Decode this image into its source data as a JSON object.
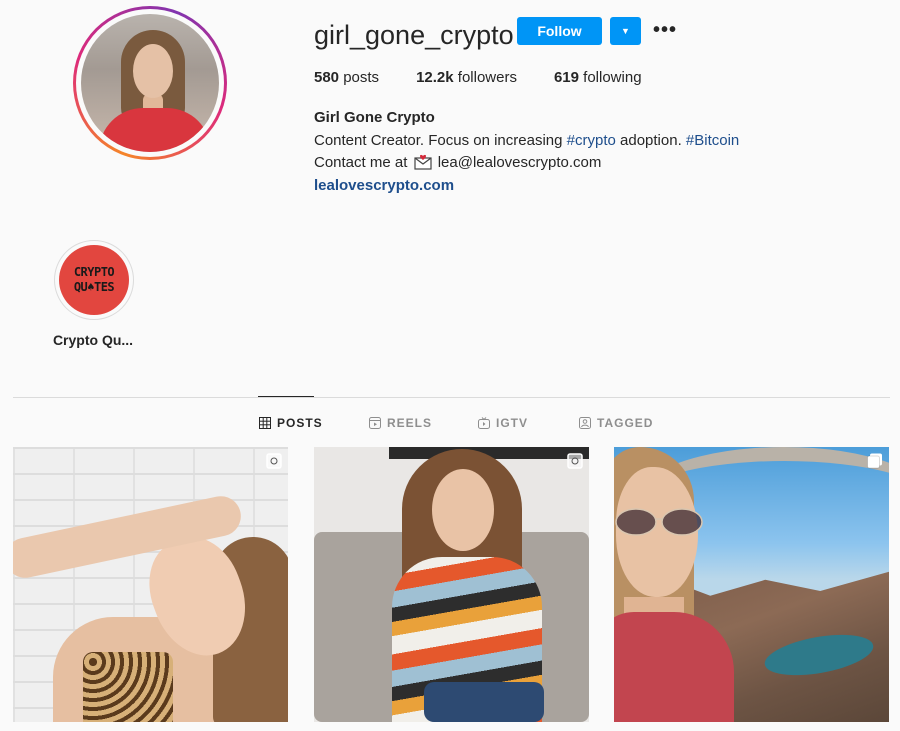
{
  "profile": {
    "username": "girl_gone_crypto",
    "follow_label": "Follow",
    "more_glyph": "•••",
    "dropdown_glyph": "▼",
    "stats": {
      "posts_count": "580",
      "posts_label": " posts",
      "followers_count": "12.2k",
      "followers_label": " followers",
      "following_count": "619",
      "following_label": " following"
    },
    "bio": {
      "name": "Girl Gone Crypto",
      "line1_prefix": "Content Creator. Focus on increasing ",
      "tag_crypto": "#crypto",
      "line1_mid": " adoption. ",
      "tag_bitcoin": "#Bitcoin",
      "line2_prefix": "Contact me at ",
      "email": "lea@lealovescrypto.com",
      "website": "lealovescrypto.com"
    }
  },
  "highlights": [
    {
      "label": "Crypto Qu...",
      "cover_line1": "CRYPTO",
      "cover_line2": "QU♠TES"
    }
  ],
  "tabs": [
    {
      "label": "POSTS",
      "icon": "grid-icon",
      "active": true
    },
    {
      "label": "REELS",
      "icon": "reels-icon",
      "active": false
    },
    {
      "label": "IGTV",
      "icon": "igtv-icon",
      "active": false
    },
    {
      "label": "TAGGED",
      "icon": "tagged-icon",
      "active": false
    }
  ],
  "posts": [
    {
      "type": "photo",
      "icon": "photo-icon"
    },
    {
      "type": "photo",
      "icon": "photo-icon"
    },
    {
      "type": "carousel",
      "icon": "carousel-icon"
    }
  ],
  "colors": {
    "accent": "#0095f6",
    "link": "#1e4e8c",
    "highlight_cover": "#e2463f"
  }
}
